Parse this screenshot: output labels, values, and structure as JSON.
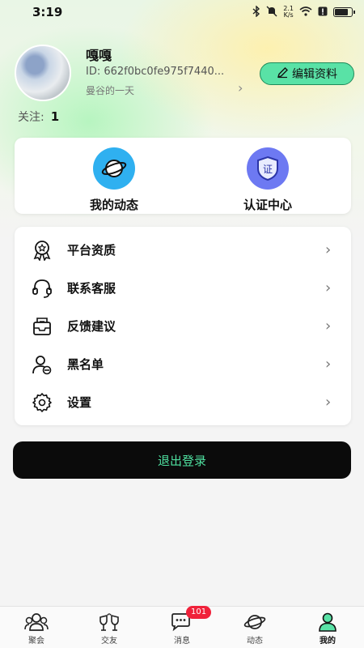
{
  "status_bar": {
    "time": "3:19",
    "net_speed_top": "2.1",
    "net_speed_bottom": "K/s"
  },
  "profile": {
    "nickname": "嘎嘎",
    "user_id": "ID: 662f0bc0fe975f7440...",
    "signature": "曼谷的一天",
    "edit_button": "编辑资料",
    "follow_label": "关注:",
    "follow_count": "1"
  },
  "quick_actions": [
    {
      "label": "我的动态",
      "icon": "planet-icon",
      "color": "#2fb0f0"
    },
    {
      "label": "认证中心",
      "icon": "verified-shield-icon",
      "color": "#6d79f2"
    }
  ],
  "menu": [
    {
      "label": "平台资质",
      "icon": "award-badge-icon"
    },
    {
      "label": "联系客服",
      "icon": "headset-icon"
    },
    {
      "label": "反馈建议",
      "icon": "mail-tray-icon"
    },
    {
      "label": "黑名单",
      "icon": "user-block-icon"
    },
    {
      "label": "设置",
      "icon": "gear-icon"
    }
  ],
  "logout_label": "退出登录",
  "tabs": [
    {
      "label": "聚会",
      "icon": "group-icon"
    },
    {
      "label": "交友",
      "icon": "cheers-icon"
    },
    {
      "label": "消息",
      "icon": "chat-icon",
      "badge": "101"
    },
    {
      "label": "动态",
      "icon": "planet-icon"
    },
    {
      "label": "我的",
      "icon": "user-icon",
      "active": true
    }
  ],
  "colors": {
    "accent": "#59e2a6",
    "logout_text": "#4fe0a0",
    "badge": "#f0213a"
  }
}
